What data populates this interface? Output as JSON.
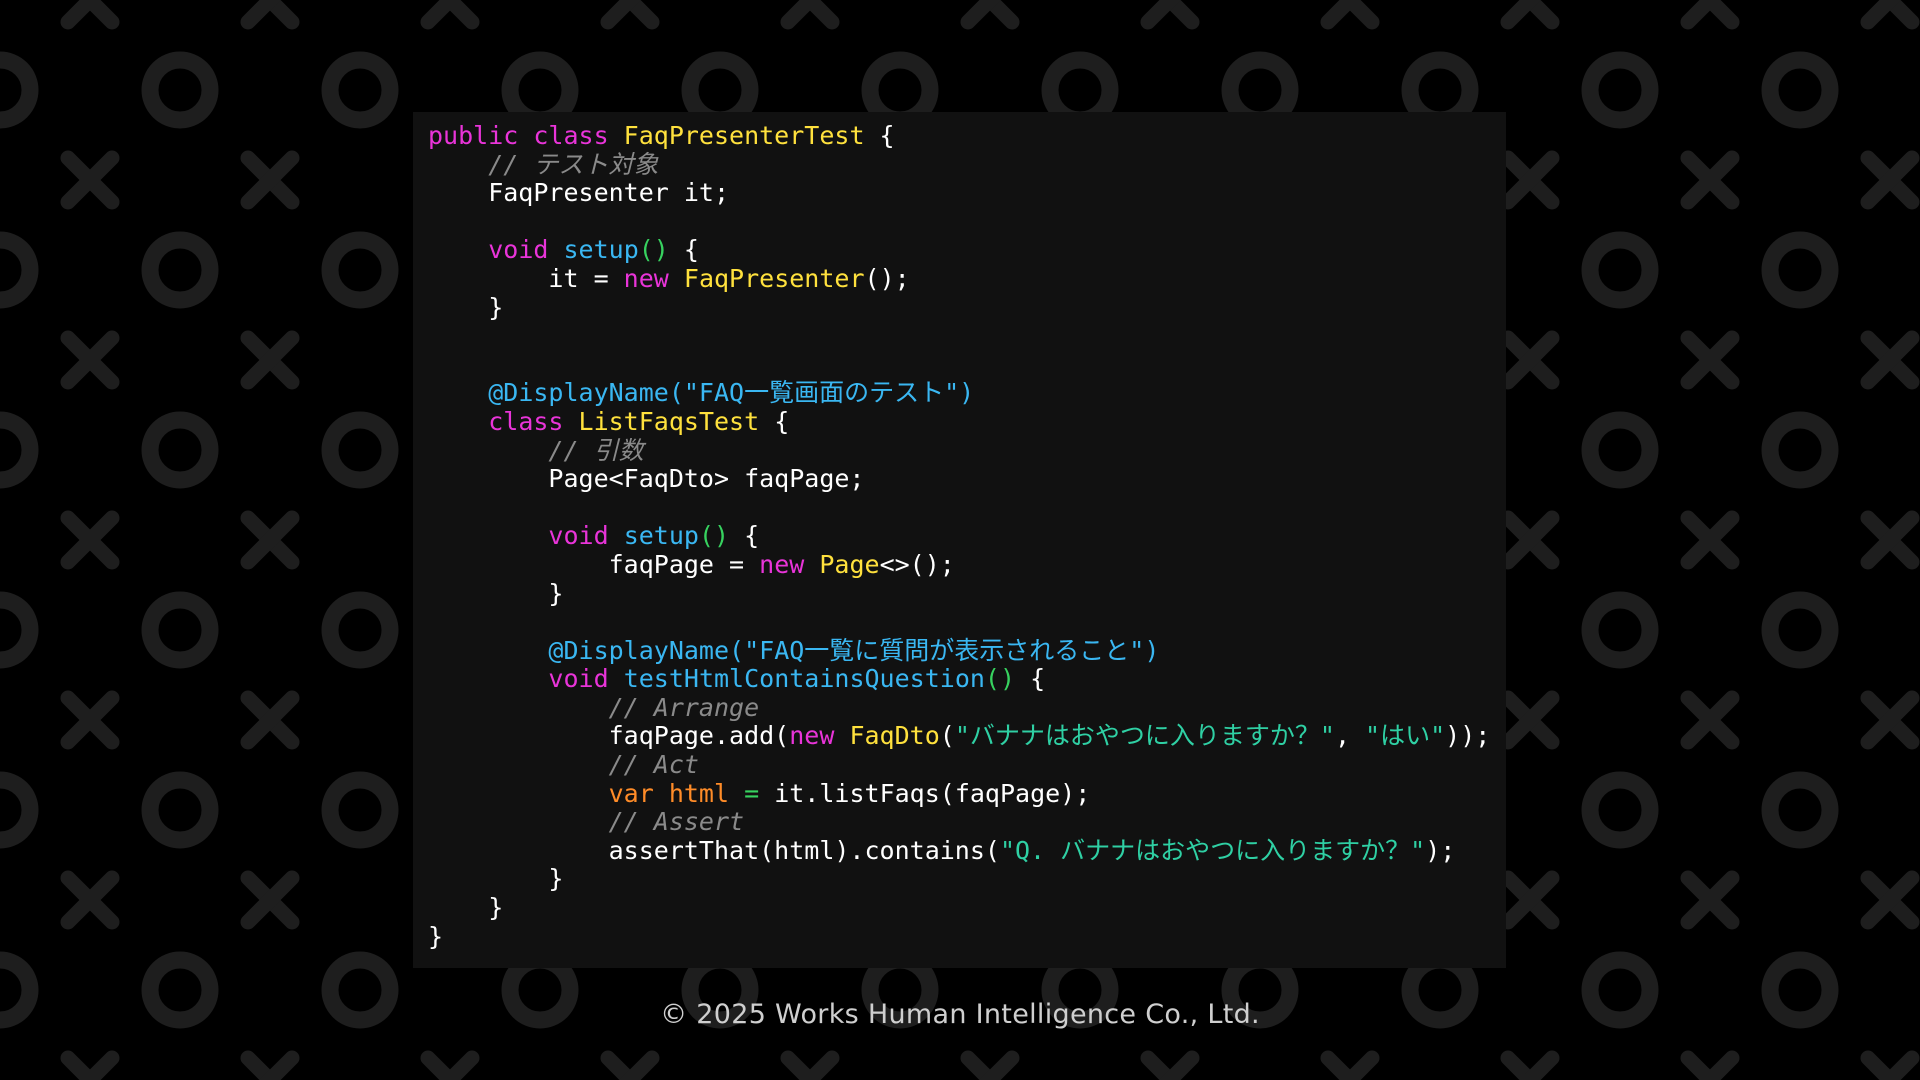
{
  "colors": {
    "background": "#000000",
    "pattern": "#1e1e1e",
    "panel": "#111111",
    "keyword": "#e934d9",
    "class_name": "#ffe13d",
    "method": "#3ab7f2",
    "string": "#2fd0a4",
    "comment": "#8a8a8a",
    "variable": "#ff8c28",
    "text": "#ffffff"
  },
  "code_lines": [
    [
      {
        "t": "kw",
        "v": "public class "
      },
      {
        "t": "cls",
        "v": "FaqPresenterTest"
      },
      {
        "t": "plain",
        "v": " {"
      }
    ],
    [
      {
        "t": "plain",
        "v": "    "
      },
      {
        "t": "cmt",
        "v": "// テスト対象"
      }
    ],
    [
      {
        "t": "plain",
        "v": "    FaqPresenter it;"
      }
    ],
    [
      {
        "t": "plain",
        "v": ""
      }
    ],
    [
      {
        "t": "plain",
        "v": "    "
      },
      {
        "t": "kw",
        "v": "void "
      },
      {
        "t": "fn",
        "v": "setup"
      },
      {
        "t": "par",
        "v": "()"
      },
      {
        "t": "plain",
        "v": " {"
      }
    ],
    [
      {
        "t": "plain",
        "v": "        it = "
      },
      {
        "t": "kw",
        "v": "new "
      },
      {
        "t": "cls",
        "v": "FaqPresenter"
      },
      {
        "t": "plain",
        "v": "();"
      }
    ],
    [
      {
        "t": "plain",
        "v": "    }"
      }
    ],
    [
      {
        "t": "plain",
        "v": ""
      }
    ],
    [
      {
        "t": "plain",
        "v": ""
      }
    ],
    [
      {
        "t": "plain",
        "v": "    "
      },
      {
        "t": "ann",
        "v": "@DisplayName(\"FAQ一覧画面のテスト\")"
      }
    ],
    [
      {
        "t": "plain",
        "v": "    "
      },
      {
        "t": "kw",
        "v": "class "
      },
      {
        "t": "cls",
        "v": "ListFaqsTest"
      },
      {
        "t": "plain",
        "v": " {"
      }
    ],
    [
      {
        "t": "plain",
        "v": "        "
      },
      {
        "t": "cmt",
        "v": "// 引数"
      }
    ],
    [
      {
        "t": "plain",
        "v": "        Page<FaqDto> faqPage;"
      }
    ],
    [
      {
        "t": "plain",
        "v": ""
      }
    ],
    [
      {
        "t": "plain",
        "v": "        "
      },
      {
        "t": "kw",
        "v": "void "
      },
      {
        "t": "fn",
        "v": "setup"
      },
      {
        "t": "par",
        "v": "()"
      },
      {
        "t": "plain",
        "v": " {"
      }
    ],
    [
      {
        "t": "plain",
        "v": "            faqPage = "
      },
      {
        "t": "kw",
        "v": "new "
      },
      {
        "t": "cls",
        "v": "Page"
      },
      {
        "t": "plain",
        "v": "<>();"
      }
    ],
    [
      {
        "t": "plain",
        "v": "        }"
      }
    ],
    [
      {
        "t": "plain",
        "v": ""
      }
    ],
    [
      {
        "t": "plain",
        "v": "        "
      },
      {
        "t": "ann",
        "v": "@DisplayName(\"FAQ一覧に質問が表示されること\")"
      }
    ],
    [
      {
        "t": "plain",
        "v": "        "
      },
      {
        "t": "kw",
        "v": "void "
      },
      {
        "t": "fn",
        "v": "testHtmlContainsQuestion"
      },
      {
        "t": "par",
        "v": "()"
      },
      {
        "t": "plain",
        "v": " {"
      }
    ],
    [
      {
        "t": "plain",
        "v": "            "
      },
      {
        "t": "cmt",
        "v": "// Arrange"
      }
    ],
    [
      {
        "t": "plain",
        "v": "            faqPage.add("
      },
      {
        "t": "kw",
        "v": "new "
      },
      {
        "t": "cls",
        "v": "FaqDto"
      },
      {
        "t": "plain",
        "v": "("
      },
      {
        "t": "str",
        "v": "\"バナナはおやつに入りますか？\""
      },
      {
        "t": "plain",
        "v": ", "
      },
      {
        "t": "str",
        "v": "\"はい\""
      },
      {
        "t": "plain",
        "v": "));"
      }
    ],
    [
      {
        "t": "plain",
        "v": "            "
      },
      {
        "t": "cmt",
        "v": "// Act"
      }
    ],
    [
      {
        "t": "plain",
        "v": "            "
      },
      {
        "t": "var",
        "v": "var html "
      },
      {
        "t": "op",
        "v": "="
      },
      {
        "t": "plain",
        "v": " it.listFaqs(faqPage);"
      }
    ],
    [
      {
        "t": "plain",
        "v": "            "
      },
      {
        "t": "cmt",
        "v": "// Assert"
      }
    ],
    [
      {
        "t": "plain",
        "v": "            assertThat(html).contains("
      },
      {
        "t": "str",
        "v": "\"Q. バナナはおやつに入りますか？\""
      },
      {
        "t": "plain",
        "v": ");"
      }
    ],
    [
      {
        "t": "plain",
        "v": "        }"
      }
    ],
    [
      {
        "t": "plain",
        "v": "    }"
      }
    ],
    [
      {
        "t": "plain",
        "v": "}"
      }
    ]
  ],
  "footer": {
    "copyright": "© 2025 Works Human Intelligence Co., Ltd."
  }
}
